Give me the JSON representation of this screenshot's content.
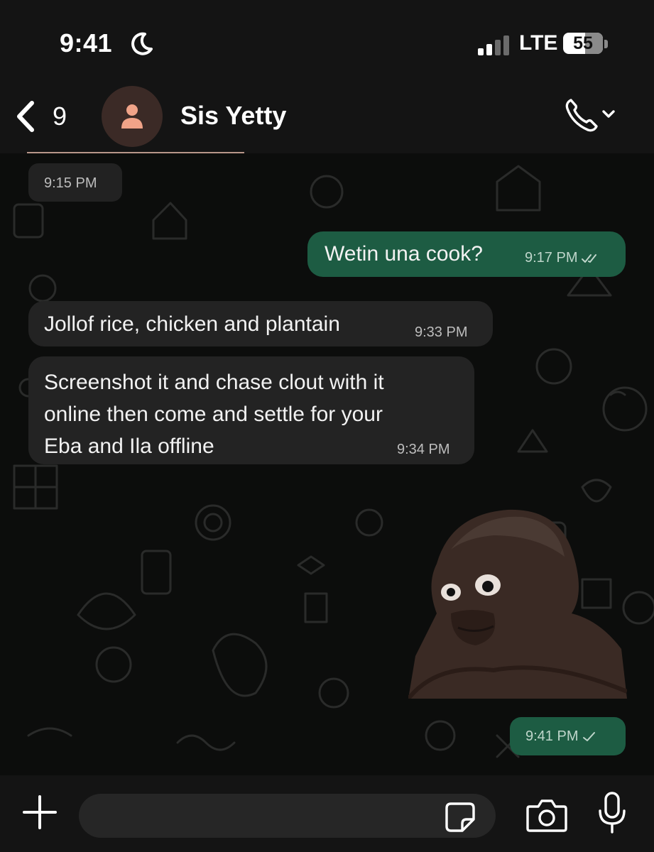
{
  "status_bar": {
    "time": "9:41",
    "network": "LTE",
    "battery": "55",
    "battery_level": 0.55,
    "icons": [
      "moon-icon",
      "signal-icon"
    ]
  },
  "header": {
    "back_count": "9",
    "contact_name": "Sis Yetty",
    "icons": [
      "back-chevron-icon",
      "person-icon",
      "phone-icon",
      "chevron-down-icon"
    ]
  },
  "messages": [
    {
      "type": "timestamp",
      "time": "9:15 PM"
    },
    {
      "type": "outgoing",
      "text": "Wetin una cook?",
      "time": "9:17 PM",
      "status": "read",
      "status_icon": "double-check-icon"
    },
    {
      "type": "incoming",
      "text": "Jollof rice, chicken and plantain",
      "time": "9:33 PM"
    },
    {
      "type": "incoming",
      "text_lines": [
        "Screenshot it and chase clout with it",
        "online then come and settle for your",
        "Eba and Ila offline"
      ],
      "time": "9:34 PM"
    },
    {
      "type": "sticker",
      "description_icon": "sticker-image"
    },
    {
      "type": "outgoing",
      "text": "",
      "time": "9:41 PM",
      "status": "sent",
      "status_icon": "single-check-icon"
    }
  ],
  "input_bar": {
    "placeholder": "",
    "icons": [
      "plus-icon",
      "sticker-icon",
      "camera-icon",
      "mic-icon"
    ]
  },
  "colors": {
    "background": "#0c0d0c",
    "bar": "#141414",
    "incoming_bubble": "#232323",
    "outgoing_bubble": "#1d5c43",
    "avatar_bg": "#3b2a26",
    "avatar_fg": "#f0a388"
  }
}
